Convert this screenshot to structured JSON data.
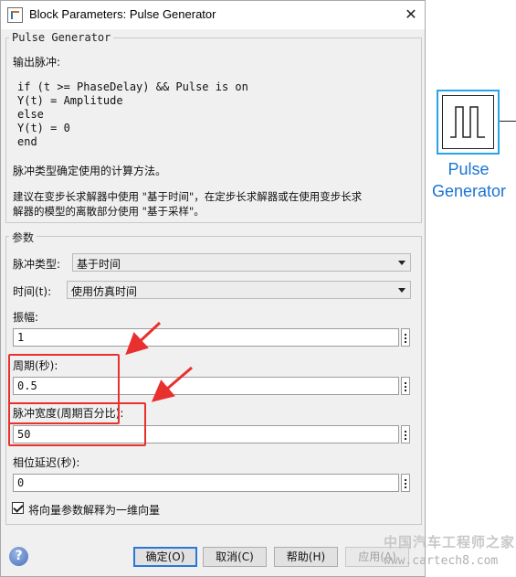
{
  "window": {
    "title": "Block Parameters: Pulse Generator",
    "close_glyph": "✕"
  },
  "description": {
    "legend": "Pulse Generator",
    "intro": "输出脉冲:",
    "code_lines": [
      "if (t >= PhaseDelay) && Pulse is on",
      "Y(t) = Amplitude",
      "else",
      "Y(t) = 0",
      "end"
    ],
    "note1": "脉冲类型确定使用的计算方法。",
    "note2_line1": "建议在变步长求解器中使用 \"基于时间\"，在定步长求解器或在使用变步长求",
    "note2_line2": "解器的模型的离散部分使用 \"基于采样\"。"
  },
  "params": {
    "legend": "参数",
    "pulse_type_label": "脉冲类型:",
    "pulse_type_value": "基于时间",
    "time_label": "时间(t):",
    "time_value": "使用仿真时间",
    "amplitude_label": "振幅:",
    "amplitude_value": "1",
    "period_label": "周期(秒):",
    "period_value": "0.5",
    "pulse_width_label": "脉冲宽度(周期百分比):",
    "pulse_width_value": "50",
    "phase_delay_label": "相位延迟(秒):",
    "phase_delay_value": "0",
    "vector_checkbox_label": "将向量参数解释为一维向量",
    "vector_checkbox_checked": true
  },
  "buttons": {
    "ok": "确定(O)",
    "cancel": "取消(C)",
    "help": "帮助(H)",
    "apply": "应用(A)"
  },
  "block": {
    "name_line1": "Pulse",
    "name_line2": "Generator",
    "accent_color": "#29a3e8",
    "label_color": "#1a73d2"
  },
  "watermark": {
    "line1": "中国汽车工程师之家",
    "line2": "www.cartech8.com"
  },
  "annotation_color": "#e8312f"
}
